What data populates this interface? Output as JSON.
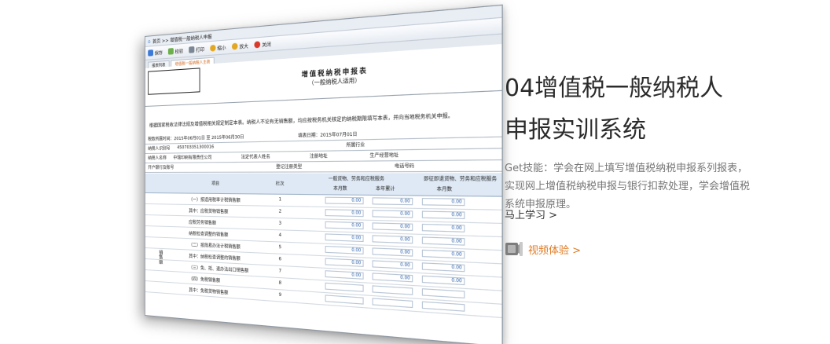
{
  "screenshot": {
    "address": "首页 >> 增值税一般纳税人申报",
    "toolbar": {
      "save": "保存",
      "check": "校验",
      "print": "打印",
      "zoom_out": "缩小",
      "zoom_in": "放大",
      "close": "关闭"
    },
    "tabs": [
      "报表列表",
      "增值税一般纳税人主表"
    ],
    "form_title": "增值税纳税申报表",
    "form_subtitle": "（一般纳税人适用）",
    "intro": "根据国家税收法律法规及增值税相关规定制定本表。纳税人不论有无销售额，均应按税务机关核定的纳税期限填写本表，并向当地税务机关申报。",
    "period": "税款所属时间：2015年06月01日  至  2015年06月30日",
    "fill_date": "填表日期：2015年07月01日",
    "taxpayer_id_label": "纳税人识别号",
    "taxpayer_id": "450703351300016",
    "industry_label": "所属行业",
    "taxpayer_name_label": "纳税人名称",
    "taxpayer_name": "中瑞印刷有限责任公司",
    "legal_rep_label": "法定代表人姓名",
    "reg_address_label": "注册地址",
    "biz_address_label": "生产经营地址",
    "bank_label": "开户银行及账号",
    "reg_type_label": "登记注册类型",
    "phone_label": "电话号码",
    "columns": {
      "item": "项目",
      "line": "栏次",
      "general_goods": "一般货物、劳务和应税服务",
      "current_month": "本月数",
      "year_total": "本年累计",
      "immediate": "即征即退货物、劳务和应税服务",
      "immediate_month": "本月数"
    },
    "side_label": "销售额",
    "rows": [
      {
        "item": "（一）按适用税率计税销售额",
        "line": "1",
        "v1": "0.00",
        "v2": "0.00",
        "v3": "0.00"
      },
      {
        "item": "其中：应税货物销售额",
        "line": "2",
        "v1": "0.00",
        "v2": "0.00",
        "v3": "0.00"
      },
      {
        "item": "应税劳务销售额",
        "line": "3",
        "v1": "0.00",
        "v2": "0.00",
        "v3": "0.00"
      },
      {
        "item": "纳税检查调整的销售额",
        "line": "4",
        "v1": "0.00",
        "v2": "0.00",
        "v3": "0.00"
      },
      {
        "item": "（二）按简易办法计税销售额",
        "line": "5",
        "v1": "0.00",
        "v2": "0.00",
        "v3": "0.00"
      },
      {
        "item": "其中：纳税检查调整的销售额",
        "line": "6",
        "v1": "0.00",
        "v2": "0.00",
        "v3": "0.00"
      },
      {
        "item": "（三）免、抵、退办法出口销售额",
        "line": "7",
        "v1": "0.00",
        "v2": "0.00",
        "v3": "0.00"
      },
      {
        "item": "（四）免税销售额",
        "line": "8",
        "v1": "",
        "v2": "",
        "v3": ""
      },
      {
        "item": "其中：免税货物销售额",
        "line": "9",
        "v1": "",
        "v2": "",
        "v3": ""
      }
    ]
  },
  "headline": {
    "line1": "04增值税一般纳税人",
    "line2": "申报实训系统"
  },
  "description": "Get技能：学会在网上填写增值税纳税申报系列报表，实现网上增值税纳税申报与银行扣款处理，学会增值税系统申报原理。",
  "learn_link": "马上学习 >",
  "video_link": "视频体验 >",
  "colors": {
    "accent": "#e07b23",
    "headline": "#2b2b2b",
    "description": "#777777"
  },
  "icons": {
    "video": "video-reel-icon"
  }
}
